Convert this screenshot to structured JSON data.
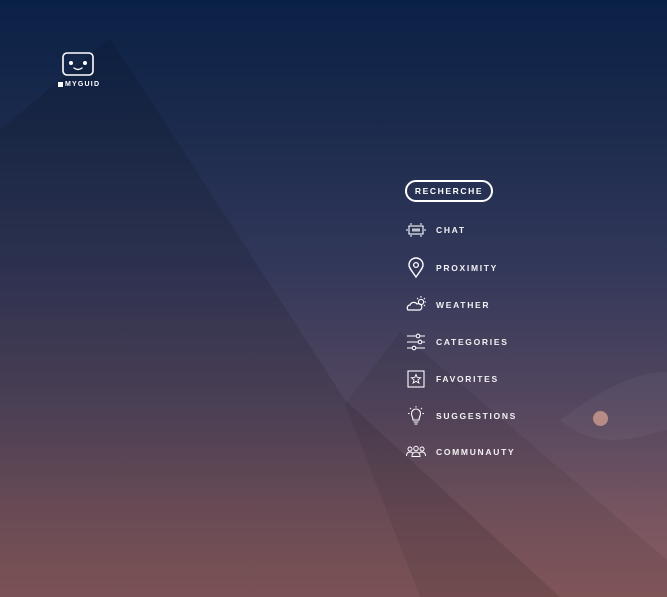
{
  "logo": {
    "text": "MYGUID",
    "icon": "robot-face-icon"
  },
  "search": {
    "label": "RECHERCHE"
  },
  "menu": [
    {
      "id": "chat",
      "label": "CHAT",
      "icon": "chat-screen-icon"
    },
    {
      "id": "proximity",
      "label": "PROXIMITY",
      "icon": "location-pin-icon"
    },
    {
      "id": "weather",
      "label": "WEATHER",
      "icon": "cloud-sun-icon"
    },
    {
      "id": "categories",
      "label": "CATEGORIES",
      "icon": "sliders-icon"
    },
    {
      "id": "favorites",
      "label": "FAVORITES",
      "icon": "star-box-icon"
    },
    {
      "id": "suggestions",
      "label": "SUGGESTIONS",
      "icon": "lightbulb-icon"
    },
    {
      "id": "communauty",
      "label": "COMMUNAUTY",
      "icon": "people-icon"
    }
  ],
  "colors": {
    "background_top": "#0a2146",
    "background_bottom": "#8a5c5f",
    "text": "#ffffff",
    "accent_dot": "#b78c87"
  }
}
